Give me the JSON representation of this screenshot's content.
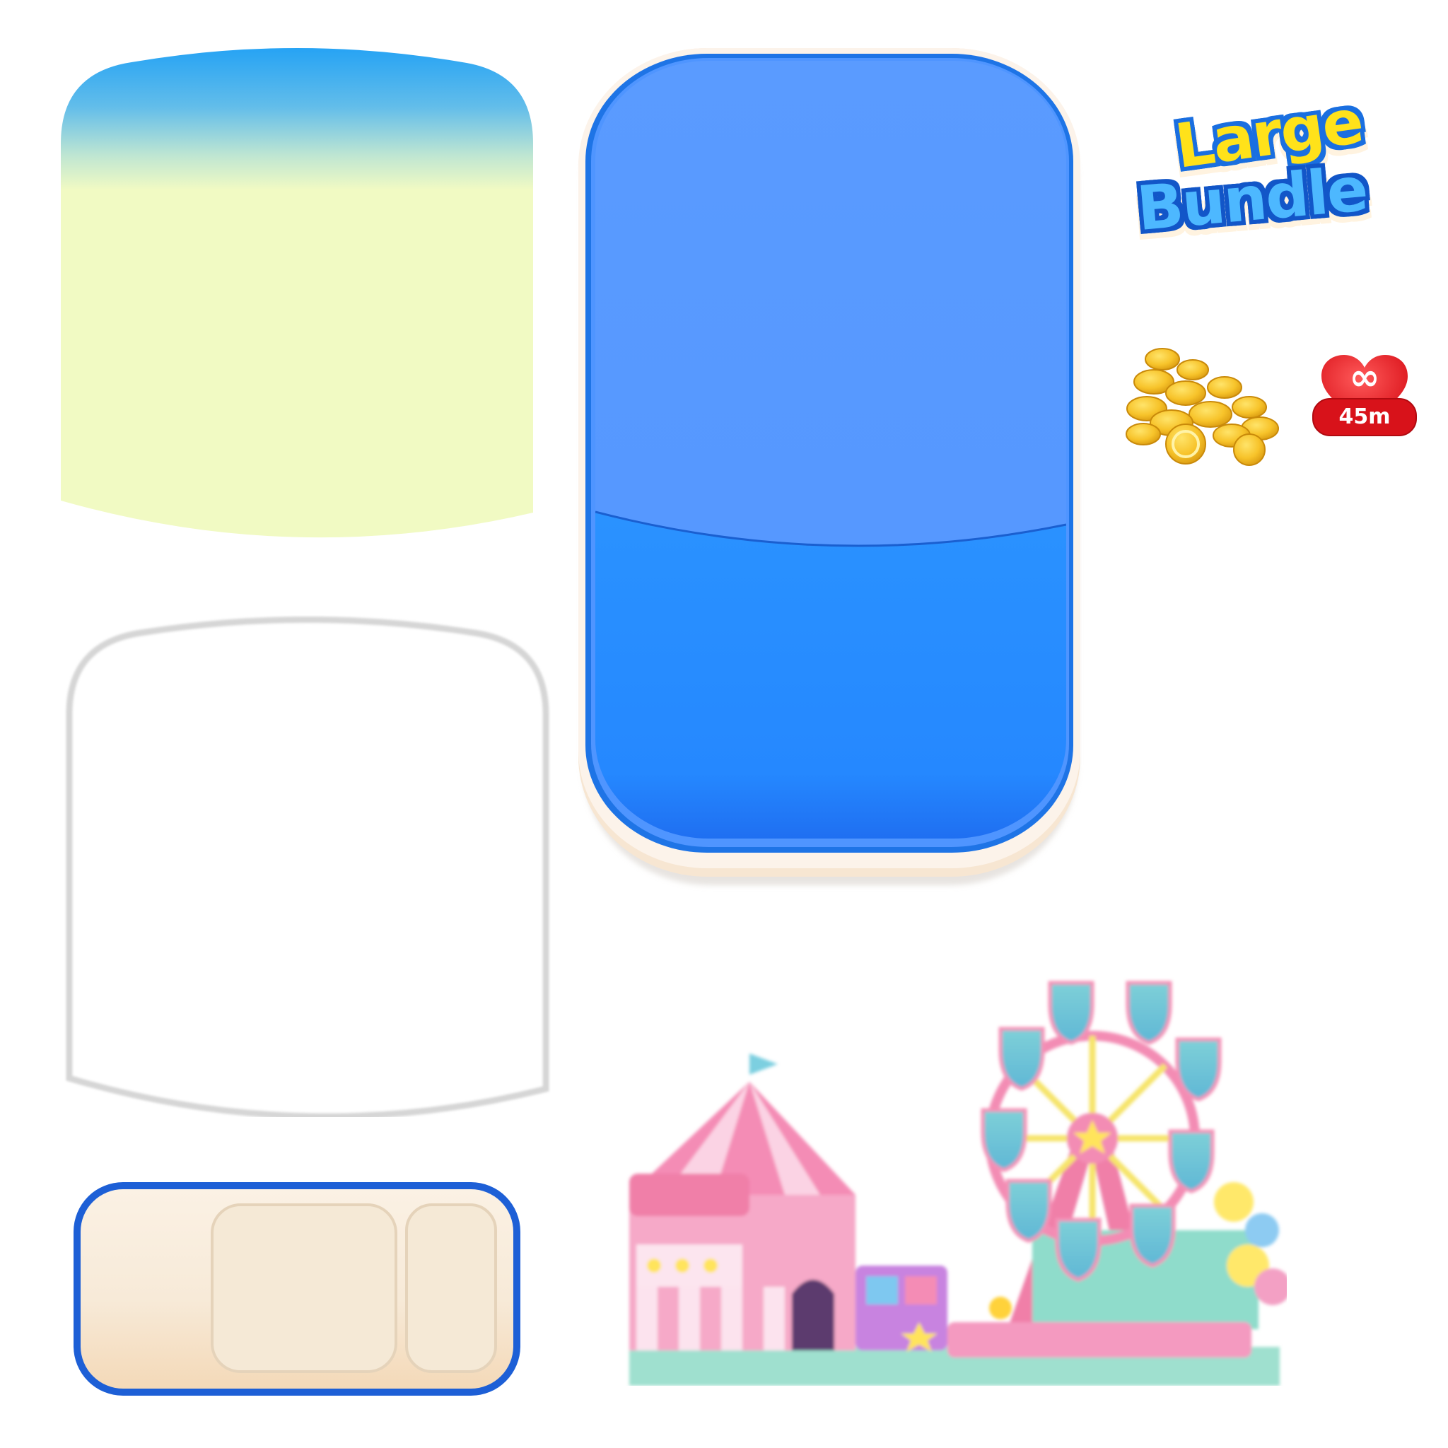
{
  "title_logo": {
    "line1": "Large",
    "line2": "Bundle"
  },
  "lives_badge": {
    "symbol": "∞",
    "timer": "45m"
  },
  "colors": {
    "sky_blue": "#2AA6F5",
    "cream": "#F1FAC3",
    "card_blue_top": "#5599FF",
    "card_blue_bottom": "#2690FF",
    "card_border": "#1E74E6",
    "card_rim": "#F6E3CF",
    "heart_red": "#E3161E",
    "coin_gold": "#F7C32A",
    "slot_border": "#1D5FD6",
    "slot_fill": "#F6E9D6"
  },
  "icons": [
    "coin-pile-icon",
    "heart-infinite-icon"
  ]
}
